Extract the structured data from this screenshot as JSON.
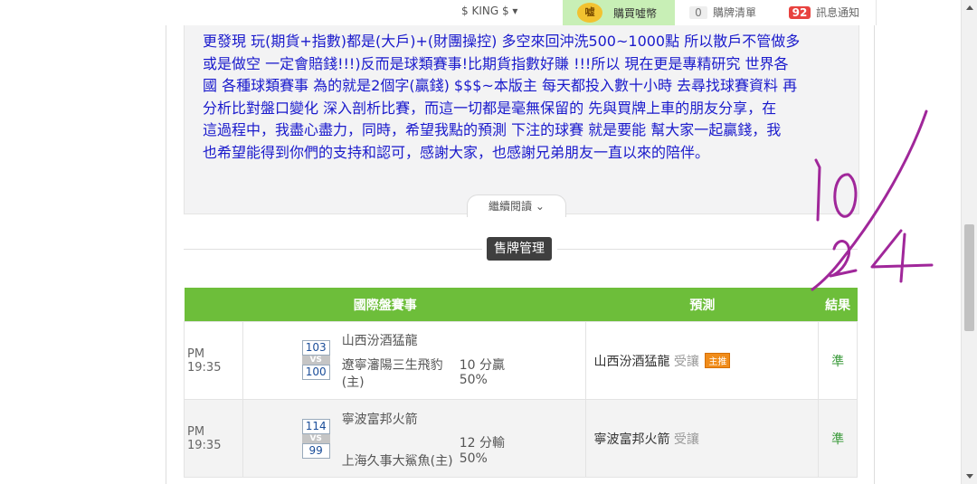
{
  "nav": {
    "user": "$ KING $",
    "dropdown_icon": "caret-down-icon",
    "coin_glyph": "嘘",
    "buy_label": "購買噓幣",
    "cart_count": "0",
    "cart_label": "購牌清單",
    "notify_count": "92",
    "notify_label": "訊息通知"
  },
  "article": {
    "lines": [
      "更發現 玩(期貨+指數)都是(大戶)+(財團操控) 多空來回沖洗500~1000點 所以散戶不管做多",
      "或是做空 一定會賠錢!!!)反而是球類賽事!比期貨指數好賺 !!!所以 現在更是專精研究 世界各",
      "國 各種球類賽事 為的就是2個字(贏錢) $$$~本版主 每天都投入數十小時 去尋找球賽資料 再",
      "分析比對盤口變化 深入剖析比賽，而這一切都是毫無保留的 先與買牌上車的朋友分享，在",
      "這過程中，我盡心盡力，同時，希望我點的預測 下注的球賽 就是要能 幫大家一起贏錢，我",
      "也希望能得到你們的支持和認可，感謝大家，也感謝兄弟朋友一直以來的陪伴。"
    ],
    "read_more": "繼續閱讀"
  },
  "section": {
    "title": "售牌管理"
  },
  "table": {
    "headers": [
      "國際盤賽事",
      "預測",
      "結果"
    ],
    "rows": [
      {
        "time": "PM 19:35",
        "home_score": "103",
        "vs": "VS",
        "away_score": "100",
        "team1": "山西汾酒猛龍",
        "team2": "遼寧瀋陽三生飛豹",
        "team2_suffix": "(主)",
        "spread": "10 分贏",
        "pct": "50%",
        "pred_team": "山西汾酒猛龍",
        "pred_type": "受讓",
        "pred_tag": "主推",
        "result": "準"
      },
      {
        "time": "PM 19:35",
        "home_score": "114",
        "vs": "VS",
        "away_score": "99",
        "team1": "寧波富邦火箭",
        "team2": "上海久事大鯊魚(主)",
        "team2_suffix": "",
        "spread": "12 分輸",
        "pct": "50%",
        "pred_team": "寧波富邦火箭",
        "pred_type": "受讓",
        "pred_tag": "",
        "result": "準"
      }
    ]
  },
  "annotation": {
    "text": "10/24",
    "color": "#a0279a"
  }
}
